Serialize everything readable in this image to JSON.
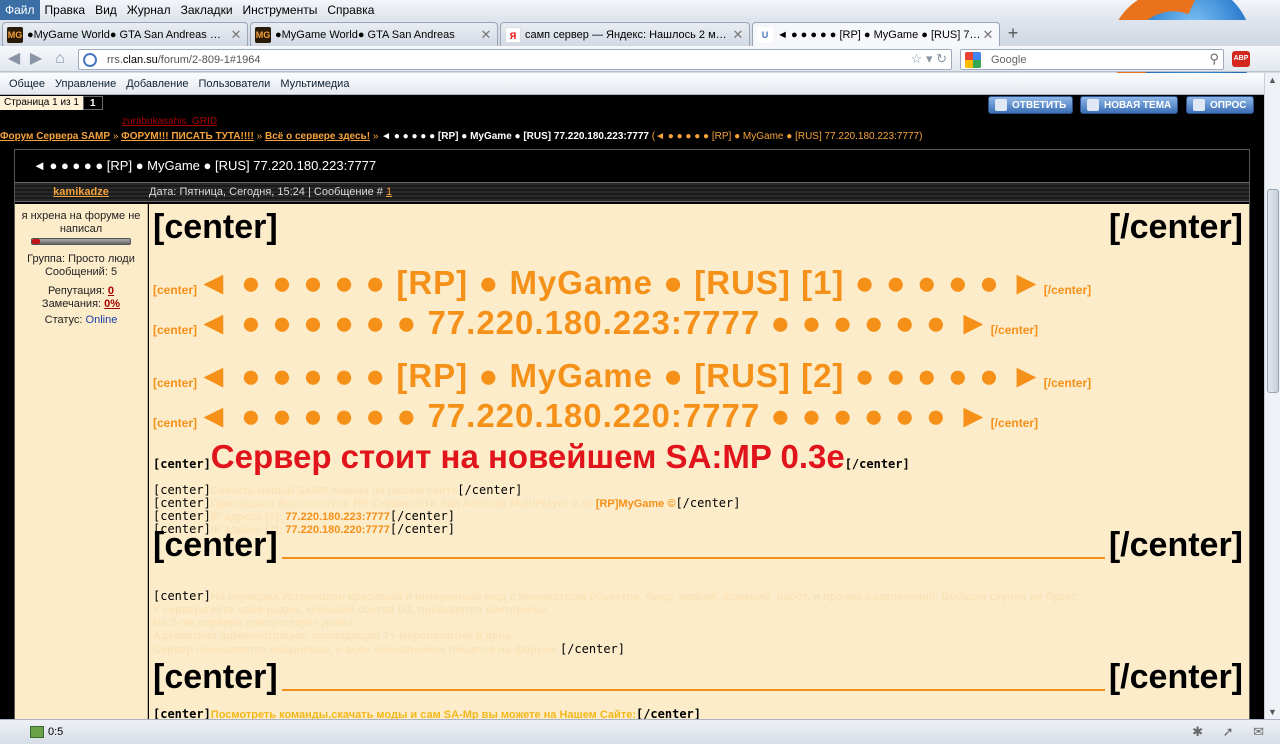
{
  "menu": [
    "Файл",
    "Правка",
    "Вид",
    "Журнал",
    "Закладки",
    "Инструменты",
    "Справка"
  ],
  "tabs": [
    {
      "icon": "MG",
      "title": "●MyGame World● GTA San Andreas Multi..."
    },
    {
      "icon": "MG",
      "title": "●MyGame World● GTA San Andreas"
    },
    {
      "icon": "Я",
      "title": "самп сервер — Яндекс: Нашлось 2 млн ..."
    },
    {
      "icon": "U",
      "title": "◄ ● ● ● ● ● [RP] ● MyGame ● [RUS] 77...."
    }
  ],
  "url": {
    "prefix": "rrs.",
    "host": "clan.su",
    "path": "/forum/2-809-1#1964"
  },
  "search": {
    "placeholder": "Google"
  },
  "admin_menu": [
    "Общее",
    "Управление",
    "Добавление",
    "Пользователи",
    "Мультимедиа"
  ],
  "pager": {
    "label": "Страница 1 из 1",
    "current": "1"
  },
  "red_link": "zurabukasahis_GRID",
  "actions": {
    "reply": "ОТВЕТИТЬ",
    "new_topic": "НОВАЯ ТЕМА",
    "poll": "ОПРОС"
  },
  "breadcrumbs": {
    "b1": "Форум Сервера SAMP",
    "b2": "ФОРУМ!!! ПИСАТЬ ТУТА!!!!",
    "b3": "Всё о сервере здесь!",
    "current": "◄ ● ● ● ● ● [RP] ● MyGame ● [RUS] 77.220.180.223:7777",
    "tail": "(◄ ● ● ● ● ● [RP] ● MyGame ● [RUS] 77.220.180.223:7777)"
  },
  "thread_title": "◄ ● ● ● ● ● [RP] ● MyGame ● [RUS] 77.220.180.223:7777",
  "post": {
    "author": "kamikadze",
    "meta_prefix": "Дата: Пятница, Сегодня, 15:24 | Сообщение #",
    "meta_num": "1"
  },
  "user": {
    "title": "я нхрена на форуме не написал",
    "rep_level": 0.08,
    "group": "Группа: Просто люди",
    "messages": "Сообщений: 5",
    "rep_label": "Репутация:",
    "rep_value": "0",
    "warn_label": "Замечания:",
    "warn_value": "0%",
    "status_label": "Статус:",
    "status_value": "Online"
  },
  "body": {
    "center_open": "[center]",
    "center_close": "[/center]",
    "l1": "◄ ● ● ● ● ● [RP] ● MyGame ● [RUS] [1] ● ● ● ● ● ►",
    "l2": "◄ ● ● ● ● ● ● 77.220.180.223:7777 ● ● ● ● ● ● ►",
    "l3": "◄ ● ● ● ● ● [RP] ● MyGame ● [RUS] [2] ● ● ● ● ● ►",
    "l4": "◄ ● ● ● ● ● ● 77.220.180.220:7777 ● ● ● ● ● ● ►",
    "red": "Сервер стоит на новейшем SA:MP 0.3e",
    "s1": "Скачать новый SAMP Можно на нашем сайте",
    "s2": "Приглашаю Вас посетить RP Сервер GTA San Andreas MultiPlayer 0.3e",
    "s2_brand": "[RP]MyGame ©",
    "s3_label": "IP адресс [1]:",
    "s3_ip": "77.220.180.223:7777",
    "s4_label": "IP адресс [2]:",
    "s4_ip": "77.220.180.220:7777",
    "p1": "На серверах Установлен красивый и интересный мод с множеством обьектов, банд, мафий, фракций, работ, и прочих развлечений. Вобщем скучно не будет.",
    "p2": "У сервера есть свое радио, хороший состав DJ, проводятся викторины.",
    "p3": "На 2-ом сервере присутствует донат.",
    "p4": "Адекватная администрация, проводящая 7+ мероприятий в день.",
    "p5": "Сервер обновляется ежедневно, о всех обновлениях пишется на форуме",
    "last": "Посмотреть команды,скачать моды и сам SA-Mp вы можете на Нашем Сайте:"
  },
  "status": {
    "text": "0:5"
  },
  "colors": {
    "accent": "#f59018",
    "red": "#e0141a",
    "post_bg": "#fdecca",
    "page_bg": "#000000"
  }
}
